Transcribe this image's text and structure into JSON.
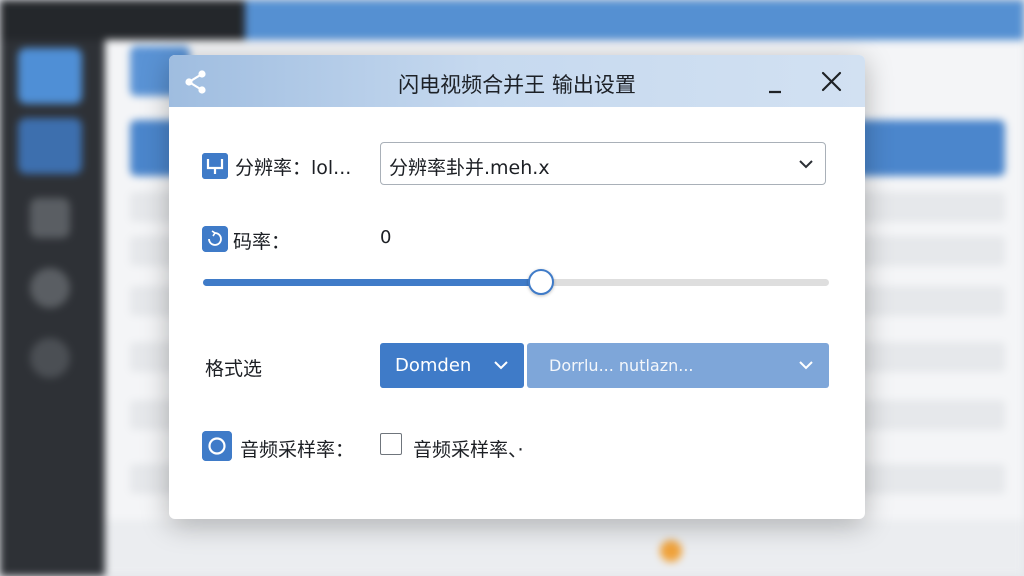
{
  "dialog": {
    "title": "闪电视频合并王 输出设置",
    "minimize_icon": "minimize-icon",
    "close_icon": "close-icon",
    "share_icon": "share-icon"
  },
  "resolution": {
    "label": "分辨率：lol...",
    "selected_value": "分辨率卦并.meh.x"
  },
  "bitrate": {
    "label": "码率：",
    "value": "0",
    "slider_fraction": 0.54
  },
  "format": {
    "label": "格式选",
    "option1": "Domden",
    "option2": "Dorrlu... nutlazn..."
  },
  "audio_sample_rate": {
    "label": "音频采样率：",
    "checkbox_label": "音频采样率、·"
  },
  "colors": {
    "accent": "#3f7bc8",
    "accent_light": "#7ea6d9",
    "titlebar": "#c6d9ef"
  }
}
